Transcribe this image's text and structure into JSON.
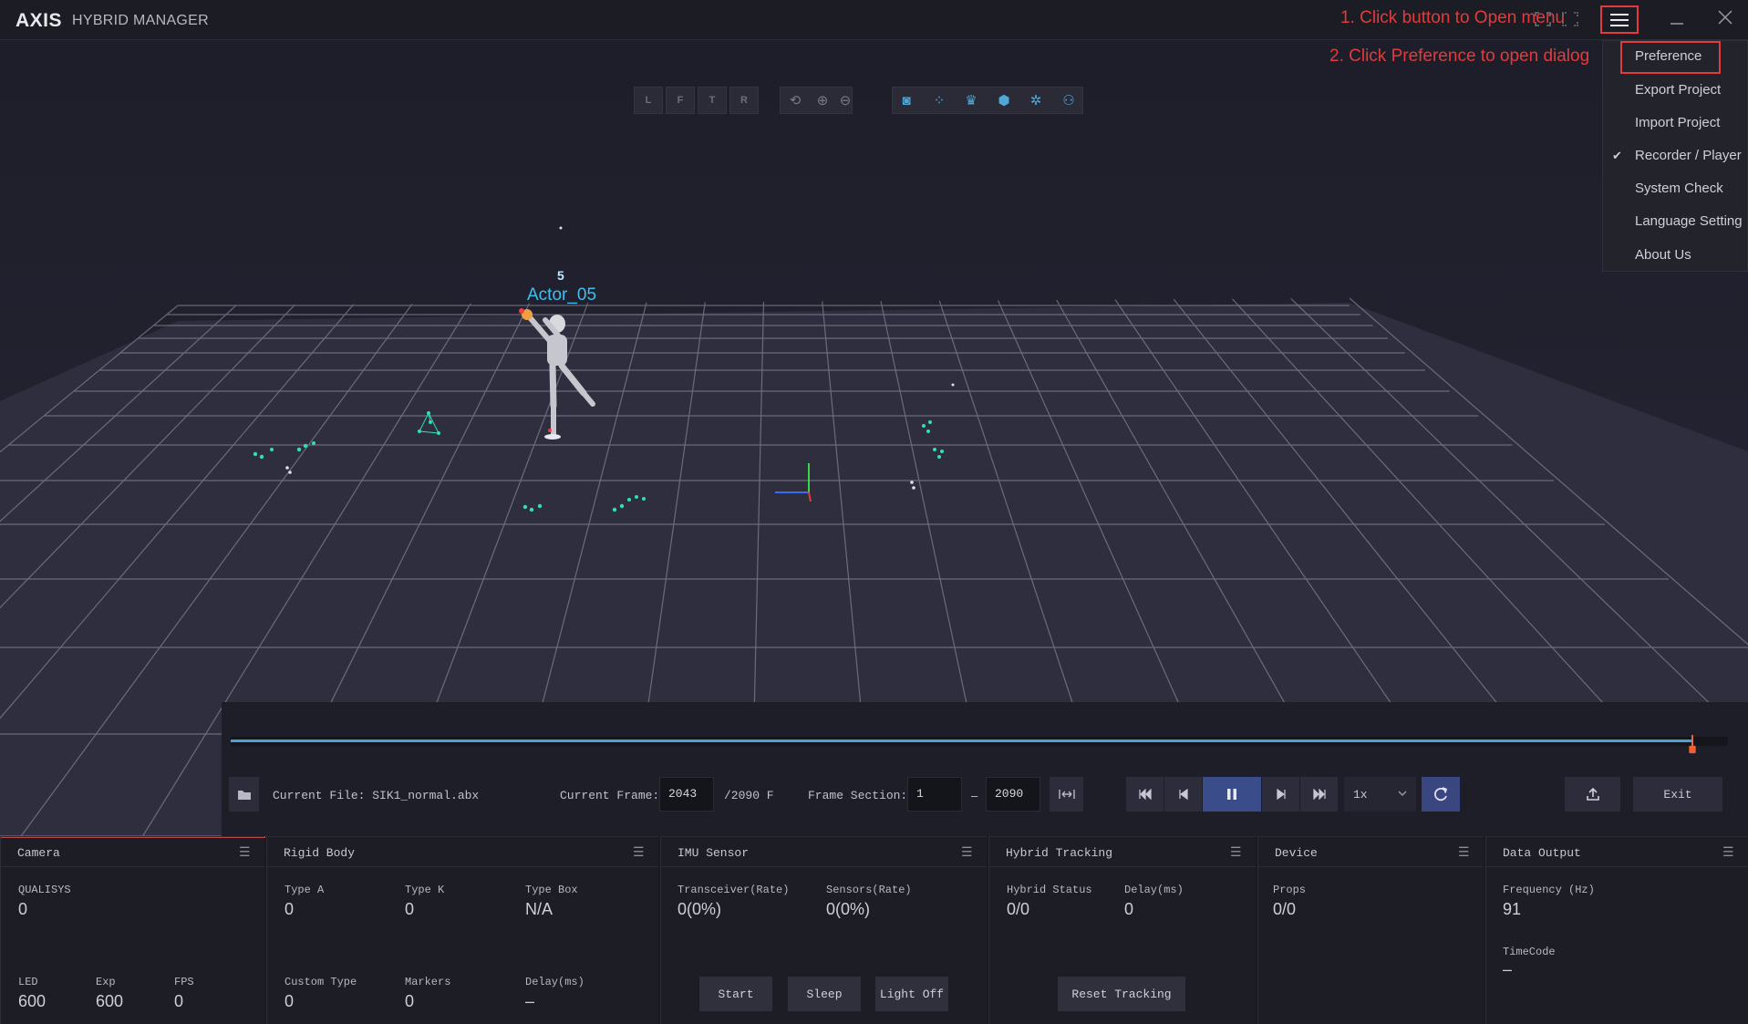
{
  "titlebar": {
    "logo": "AXIS",
    "subtitle": "HYBRID MANAGER",
    "annotation_1": "1. Click button to Open menu",
    "annotation_2": "2. Click Preference to open dialog",
    "icons": [
      "screenshot-icon",
      "fullscreen-icon",
      "hamburger-menu-icon",
      "minimize-icon",
      "close-icon"
    ]
  },
  "view_toolbar": {
    "view_buttons": [
      "L",
      "F",
      "T",
      "R"
    ]
  },
  "scene": {
    "actor_id": "5",
    "actor_name": "Actor_05"
  },
  "menu": {
    "items": [
      {
        "label": "Preference",
        "checked": false
      },
      {
        "label": "Export Project",
        "checked": false
      },
      {
        "label": "Import Project",
        "checked": false
      },
      {
        "label": "Recorder / Player",
        "checked": true
      },
      {
        "label": "System Check",
        "checked": false
      },
      {
        "label": "Language Setting",
        "checked": false
      },
      {
        "label": "About Us",
        "checked": false
      }
    ],
    "check_glyph": "✔"
  },
  "playback": {
    "current_file_label": "Current File: SIK1_normal.abx",
    "current_frame_label": "Current Frame:",
    "current_frame": "2043",
    "total_frames": "/2090 F",
    "frame_section_label": "Frame Section:",
    "section_start": "1",
    "section_dash": "–",
    "section_end": "2090",
    "speed": "1x",
    "exit_label": "Exit",
    "progress": 0.976
  },
  "panels": {
    "camera": {
      "title": "Camera",
      "qualisys_label": "QUALISYS",
      "qualisys_value": "0",
      "led_label": "LED",
      "led_value": "600",
      "exp_label": "Exp",
      "exp_value": "600",
      "fps_label": "FPS",
      "fps_value": "0"
    },
    "rigid_body": {
      "title": "Rigid Body",
      "type_a_label": "Type A",
      "type_a_value": "0",
      "type_k_label": "Type K",
      "type_k_value": "0",
      "type_box_label": "Type Box",
      "type_box_value": "N/A",
      "custom_type_label": "Custom Type",
      "custom_type_value": "0",
      "markers_label": "Markers",
      "markers_value": "0",
      "delay_label": "Delay(ms)",
      "delay_value": "–"
    },
    "imu_sensor": {
      "title": "IMU Sensor",
      "transceiver_label": "Transceiver(Rate)",
      "transceiver_value": "0(0%)",
      "sensors_label": "Sensors(Rate)",
      "sensors_value": "0(0%)",
      "start_label": "Start",
      "sleep_label": "Sleep",
      "light_off_label": "Light Off"
    },
    "hybrid_tracking": {
      "title": "Hybrid Tracking",
      "status_label": "Hybrid Status",
      "status_value": "0/0",
      "delay_label": "Delay(ms)",
      "delay_value": "0",
      "reset_label": "Reset Tracking"
    },
    "device": {
      "title": "Device",
      "props_label": "Props",
      "props_value": "0/0"
    },
    "data_output": {
      "title": "Data Output",
      "frequency_label": "Frequency (Hz)",
      "frequency_value": "91",
      "timecode_label": "TimeCode",
      "timecode_value": "–"
    }
  }
}
